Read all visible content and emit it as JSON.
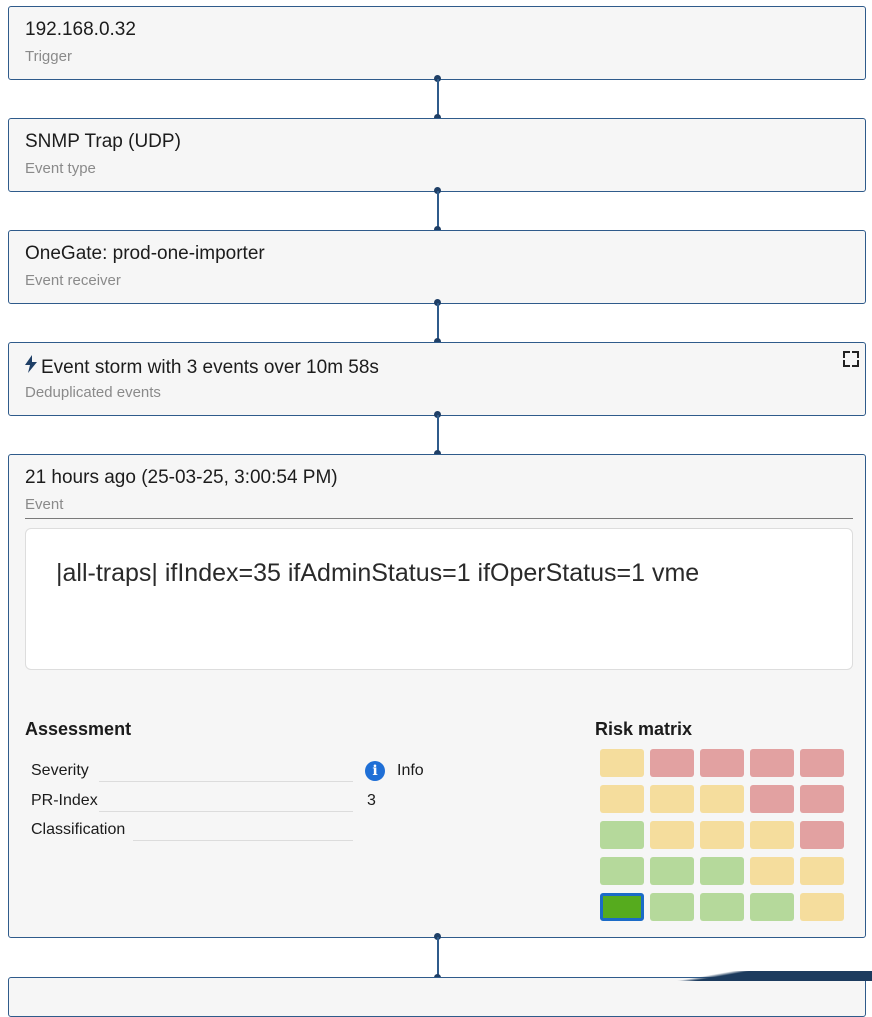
{
  "cards": [
    {
      "title": "192.168.0.32",
      "subtitle": "Trigger"
    },
    {
      "title": "SNMP Trap (UDP)",
      "subtitle": "Event type"
    },
    {
      "title": "OneGate: prod-one-importer",
      "subtitle": "Event receiver"
    },
    {
      "title": "Event storm with 3 events over 10m 58s",
      "subtitle": "Deduplicated events",
      "icon": "lightning-bolt-icon",
      "action_icon": "fullscreen-icon"
    }
  ],
  "event": {
    "title": "21 hours ago (25-03-25, 3:00:54 PM)",
    "subtitle": "Event",
    "message": "|all-traps| ifIndex=35 ifAdminStatus=1 ifOperStatus=1 vme",
    "assessment": {
      "heading": "Assessment",
      "rows": [
        {
          "key": "Severity",
          "value": "Info",
          "icon": "info-icon"
        },
        {
          "key": "PR-Index",
          "value": "3"
        },
        {
          "key": "Classification",
          "value": ""
        }
      ]
    },
    "risk_matrix": {
      "heading": "Risk matrix",
      "grid": [
        [
          "yellow",
          "red",
          "red",
          "red",
          "red"
        ],
        [
          "yellow",
          "yellow",
          "yellow",
          "red",
          "red"
        ],
        [
          "green",
          "yellow",
          "yellow",
          "yellow",
          "red"
        ],
        [
          "green",
          "green",
          "green",
          "yellow",
          "yellow"
        ],
        [
          "selected",
          "green",
          "green",
          "green",
          "yellow"
        ]
      ],
      "selected_row": 5,
      "selected_col": 1
    }
  },
  "colors": {
    "border": "#2f5b8b",
    "card_bg": "#f6f6f6",
    "risk_yellow": "#f5dd9d",
    "risk_red": "#e2a1a1",
    "risk_green": "#b5d99b",
    "risk_selected": "#56ab1e",
    "info_blue": "#1f6fd6"
  }
}
